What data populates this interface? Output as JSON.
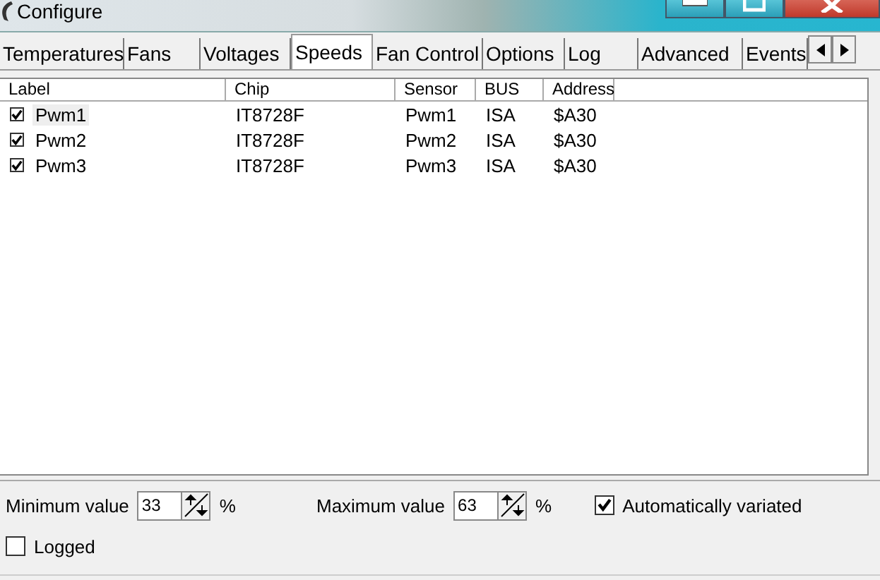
{
  "window": {
    "title": "Configure"
  },
  "tabs": [
    {
      "label": "Temperatures",
      "selected": false
    },
    {
      "label": "Fans",
      "selected": false
    },
    {
      "label": "Voltages",
      "selected": false
    },
    {
      "label": "Speeds",
      "selected": true
    },
    {
      "label": "Fan Control",
      "selected": false
    },
    {
      "label": "Options",
      "selected": false
    },
    {
      "label": "Log",
      "selected": false
    },
    {
      "label": "Advanced",
      "selected": false
    },
    {
      "label": "Events",
      "selected": false
    }
  ],
  "table": {
    "columns": [
      "Label",
      "Chip",
      "Sensor",
      "BUS",
      "Address"
    ],
    "rows": [
      {
        "checked": true,
        "selected": true,
        "cells": [
          "Pwm1",
          "IT8728F",
          "Pwm1",
          "ISA",
          "$A30"
        ]
      },
      {
        "checked": true,
        "selected": false,
        "cells": [
          "Pwm2",
          "IT8728F",
          "Pwm2",
          "ISA",
          "$A30"
        ]
      },
      {
        "checked": true,
        "selected": false,
        "cells": [
          "Pwm3",
          "IT8728F",
          "Pwm3",
          "ISA",
          "$A30"
        ]
      }
    ]
  },
  "min": {
    "label": "Minimum value",
    "value": "33",
    "unit": "%"
  },
  "max": {
    "label": "Maximum value",
    "value": "63",
    "unit": "%"
  },
  "auto": {
    "label": "Automatically variated",
    "checked": true
  },
  "logged": {
    "label": "Logged",
    "checked": false
  }
}
